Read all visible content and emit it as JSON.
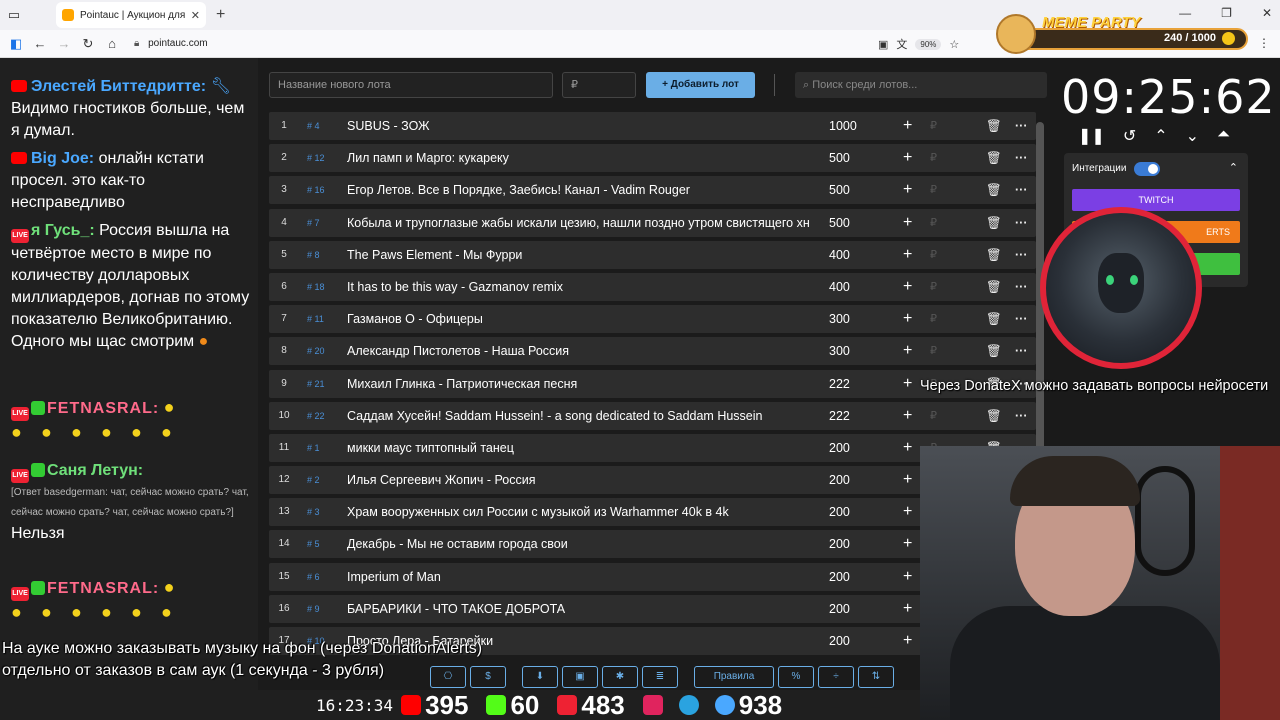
{
  "browser": {
    "tab_title": "Pointauc | Аукцион для стрим",
    "url": "pointauc.com",
    "zoom": "90%"
  },
  "meme_badge": {
    "title": "MEME PARTY",
    "count": "240 / 1000"
  },
  "chat": {
    "m1": {
      "nick": "Элестей Биттедритте:",
      "text": "Видимо гностиков больше, чем я думал."
    },
    "m2": {
      "nick": "Big Joe:",
      "text": "онлайн кстати просел. это как-то несправедливо"
    },
    "m3": {
      "nick": "я Гусь_:",
      "text": "Россия вышла на четвёртое место в мире по количеству долларовых миллиардеров, догнав по этому показателю Великобританию. Одного мы щас смотрим"
    },
    "m4": {
      "nick": "FETNASRAL:"
    },
    "m5": {
      "nick": "Саня Летун:",
      "reply": "[Ответ basedgerman: чат, сейчас можно срать? чат, сейчас можно срать? чат, сейчас можно срать?]",
      "text": "Нельзя"
    },
    "m6": {
      "nick": "FETNASRAL:"
    }
  },
  "auction": {
    "new_lot_placeholder": "Название нового лота",
    "amount_placeholder": "₽",
    "add_button": "Добавить лот",
    "search_placeholder": "Поиск среди лотов...",
    "lots": [
      {
        "n": "1",
        "id": "# 4",
        "name": "SUBUS - ЗОЖ",
        "amount": "1000"
      },
      {
        "n": "2",
        "id": "# 12",
        "name": "Лил памп и Марго: кукареку",
        "amount": "500"
      },
      {
        "n": "3",
        "id": "# 16",
        "name": "Егор Летов. Все в Порядке, Заебись! Канал - Vadim Rouger",
        "amount": "500"
      },
      {
        "n": "4",
        "id": "# 7",
        "name": "Кобыла и трупоглазые жабы искали цезию, нашли поздно утром свистящего хна",
        "amount": "500"
      },
      {
        "n": "5",
        "id": "# 8",
        "name": "The Paws Element - Мы Фурри",
        "amount": "400"
      },
      {
        "n": "6",
        "id": "# 18",
        "name": "It has to be this way - Gazmanov remix",
        "amount": "400"
      },
      {
        "n": "7",
        "id": "# 11",
        "name": "Газманов О - Офицеры",
        "amount": "300"
      },
      {
        "n": "8",
        "id": "# 20",
        "name": "Александр Пистолетов - Наша Россия",
        "amount": "300"
      },
      {
        "n": "9",
        "id": "# 21",
        "name": "Михаил Глинка - Патриотическая песня",
        "amount": "222"
      },
      {
        "n": "10",
        "id": "# 22",
        "name": "Саддам Хусейн! Saddam Hussein! - a song dedicated to Saddam Hussein",
        "amount": "222"
      },
      {
        "n": "11",
        "id": "# 1",
        "name": "микки маус типтопный танец",
        "amount": "200"
      },
      {
        "n": "12",
        "id": "# 2",
        "name": "Илья Сергеевич Жопич - Россия",
        "amount": "200"
      },
      {
        "n": "13",
        "id": "# 3",
        "name": "Храм вооруженных сил России с музыкой из Warhammer 40k в 4k",
        "amount": "200"
      },
      {
        "n": "14",
        "id": "# 5",
        "name": "Декабрь - Мы не оставим города свои",
        "amount": "200"
      },
      {
        "n": "15",
        "id": "# 6",
        "name": "Imperium of Man",
        "amount": "200"
      },
      {
        "n": "16",
        "id": "# 9",
        "name": "БАРБАРИКИ - ЧТО ТАКОЕ ДОБРОТА",
        "amount": "200"
      },
      {
        "n": "17",
        "id": "# 10",
        "name": "Просто Лера - Батарейки",
        "amount": "200"
      }
    ],
    "toolbar": {
      "rules": "Правила"
    }
  },
  "timer": {
    "value": "09:25:62"
  },
  "integrations": {
    "label": "Интеграции",
    "twitch": "TWITCH",
    "alerts": "ERTS"
  },
  "overlay": {
    "donatex": "Через DonateX можно задавать вопросы нейросети",
    "caption_line1": "На ауке можно заказывать музыку на фон (через DonationAlerts)",
    "caption_line2": "отдельно от заказов в сам аук (1 секунда - 3 рубля)"
  },
  "stats": {
    "clock": "16:23:34",
    "youtube": "395",
    "kick": "60",
    "live": "483",
    "telegram_label": "",
    "viewers": "938"
  },
  "colors": {
    "accent_blue": "#6aaee6",
    "twitch": "#7b3fe4",
    "alerts": "#f07a1a",
    "avatar_ring": "#e02438"
  }
}
